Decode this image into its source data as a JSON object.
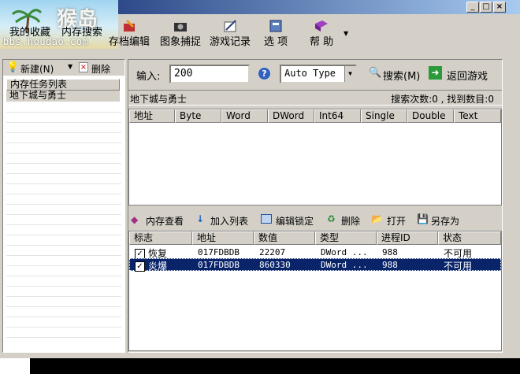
{
  "window": {
    "title_icon": "app-icon"
  },
  "logo": {
    "url": "bbs.houdao.com",
    "brand": "猴岛"
  },
  "toolbar": {
    "items": [
      {
        "label": "我的收藏",
        "icon": "star-icon"
      },
      {
        "label": "内存搜索",
        "icon": "magnifier-icon"
      },
      {
        "label": "存档编辑",
        "icon": "floppy-edit-icon"
      },
      {
        "label": "图象捕捉",
        "icon": "camera-icon"
      },
      {
        "label": "游戏记录",
        "icon": "pen-icon"
      },
      {
        "label": "选 项",
        "icon": "options-icon"
      },
      {
        "label": "帮 助",
        "icon": "help-book-icon"
      }
    ]
  },
  "left": {
    "new_label": "新建(N)",
    "delete_label": "删除",
    "header": "内存任务列表",
    "selected_item": "地下城与勇士"
  },
  "search": {
    "input_label": "输入:",
    "input_value": "200",
    "type_value": "Auto Type",
    "search_label": "搜索(M)",
    "return_label": "返回游戏",
    "process_name": "地下城与勇士",
    "status": "搜索次数:0 , 找到数目:0"
  },
  "results_columns": [
    "地址",
    "Byte",
    "Word",
    "DWord",
    "Int64",
    "Single",
    "Double",
    "Text"
  ],
  "locked_toolbar": {
    "view": "内存查看",
    "add": "加入列表",
    "edit": "编辑锁定",
    "delete": "删除",
    "open": "打开",
    "save_as": "另存为"
  },
  "locked_columns": [
    "标志",
    "地址",
    "数值",
    "类型",
    "进程ID",
    "状态"
  ],
  "locked_rows": [
    {
      "flag": "恢复",
      "address": "017FDBDB",
      "value": "22207",
      "type": "DWord ...",
      "pid": "988",
      "status": "不可用"
    },
    {
      "flag": "炎爆",
      "address": "017FDBDB",
      "value": "860330",
      "type": "DWord ...",
      "pid": "988",
      "status": "不可用"
    }
  ]
}
